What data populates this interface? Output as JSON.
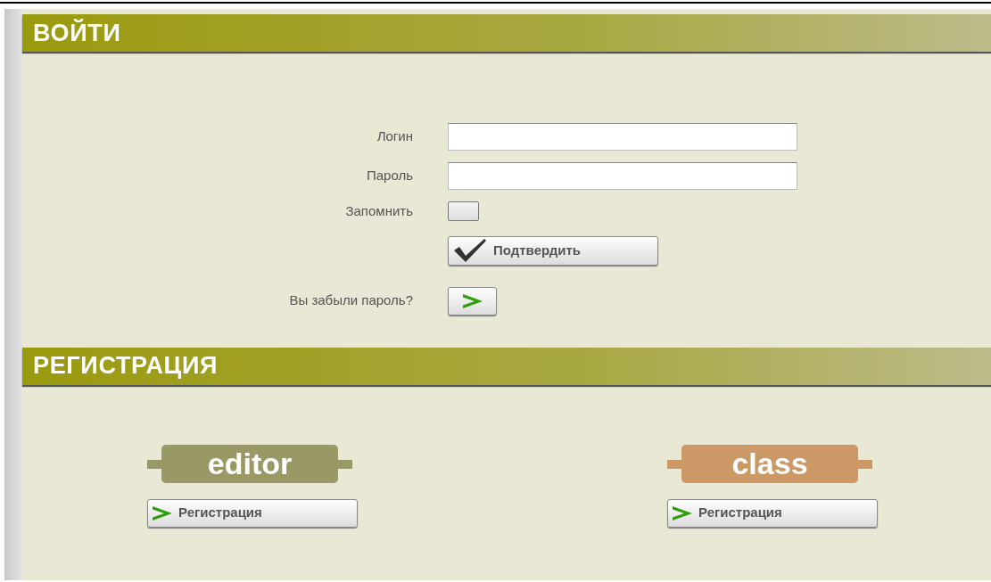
{
  "login": {
    "title": "ВОЙТИ",
    "fields": [
      {
        "label": "Логин"
      },
      {
        "label": "Пароль"
      }
    ],
    "remember": {
      "label": "Запомнить",
      "checked": false
    },
    "submit": "Подтвердить",
    "forgot": "Вы забыли пароль?"
  },
  "registration": {
    "title": "РЕГИСТРАЦИЯ",
    "options": [
      {
        "tag": "editor",
        "color": "#999966",
        "button": "Регистрация"
      },
      {
        "tag": "class",
        "color": "#cc9966",
        "button": "Регистрация"
      }
    ]
  }
}
